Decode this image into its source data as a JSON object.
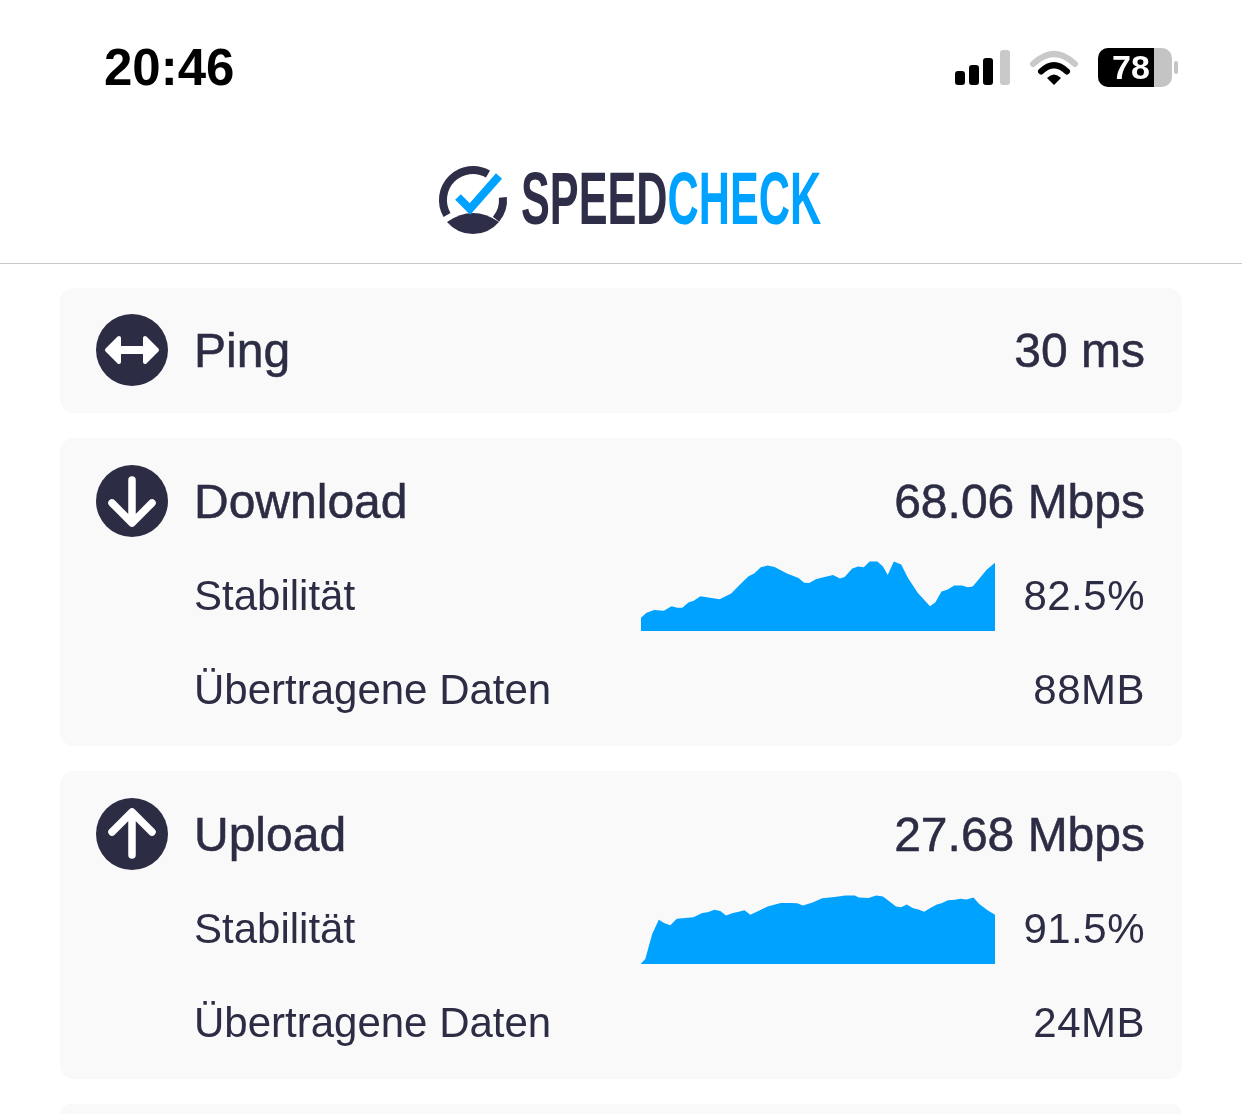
{
  "status_bar": {
    "time": "20:46",
    "battery": "78"
  },
  "header": {
    "logo": [
      {
        "text": "SPEED",
        "color": "#2e2e48"
      },
      {
        "text": "CHECK",
        "color": "#00a2ff"
      }
    ]
  },
  "metrics": [
    {
      "kind": "ping",
      "label": "Ping",
      "value": "30 ms"
    },
    {
      "kind": "download",
      "label": "Download",
      "value": "68.06 Mbps",
      "details": [
        {
          "kind": "stability",
          "label": "Stabilität",
          "value": "82.5%"
        },
        {
          "kind": "data",
          "label": "Übertragene Daten",
          "value": "88MB"
        }
      ]
    },
    {
      "kind": "upload",
      "label": "Upload",
      "value": "27.68 Mbps",
      "details": [
        {
          "kind": "stability",
          "label": "Stabilität",
          "value": "91.5%"
        },
        {
          "kind": "data",
          "label": "Übertragene Daten",
          "value": "24MB"
        }
      ]
    }
  ]
}
